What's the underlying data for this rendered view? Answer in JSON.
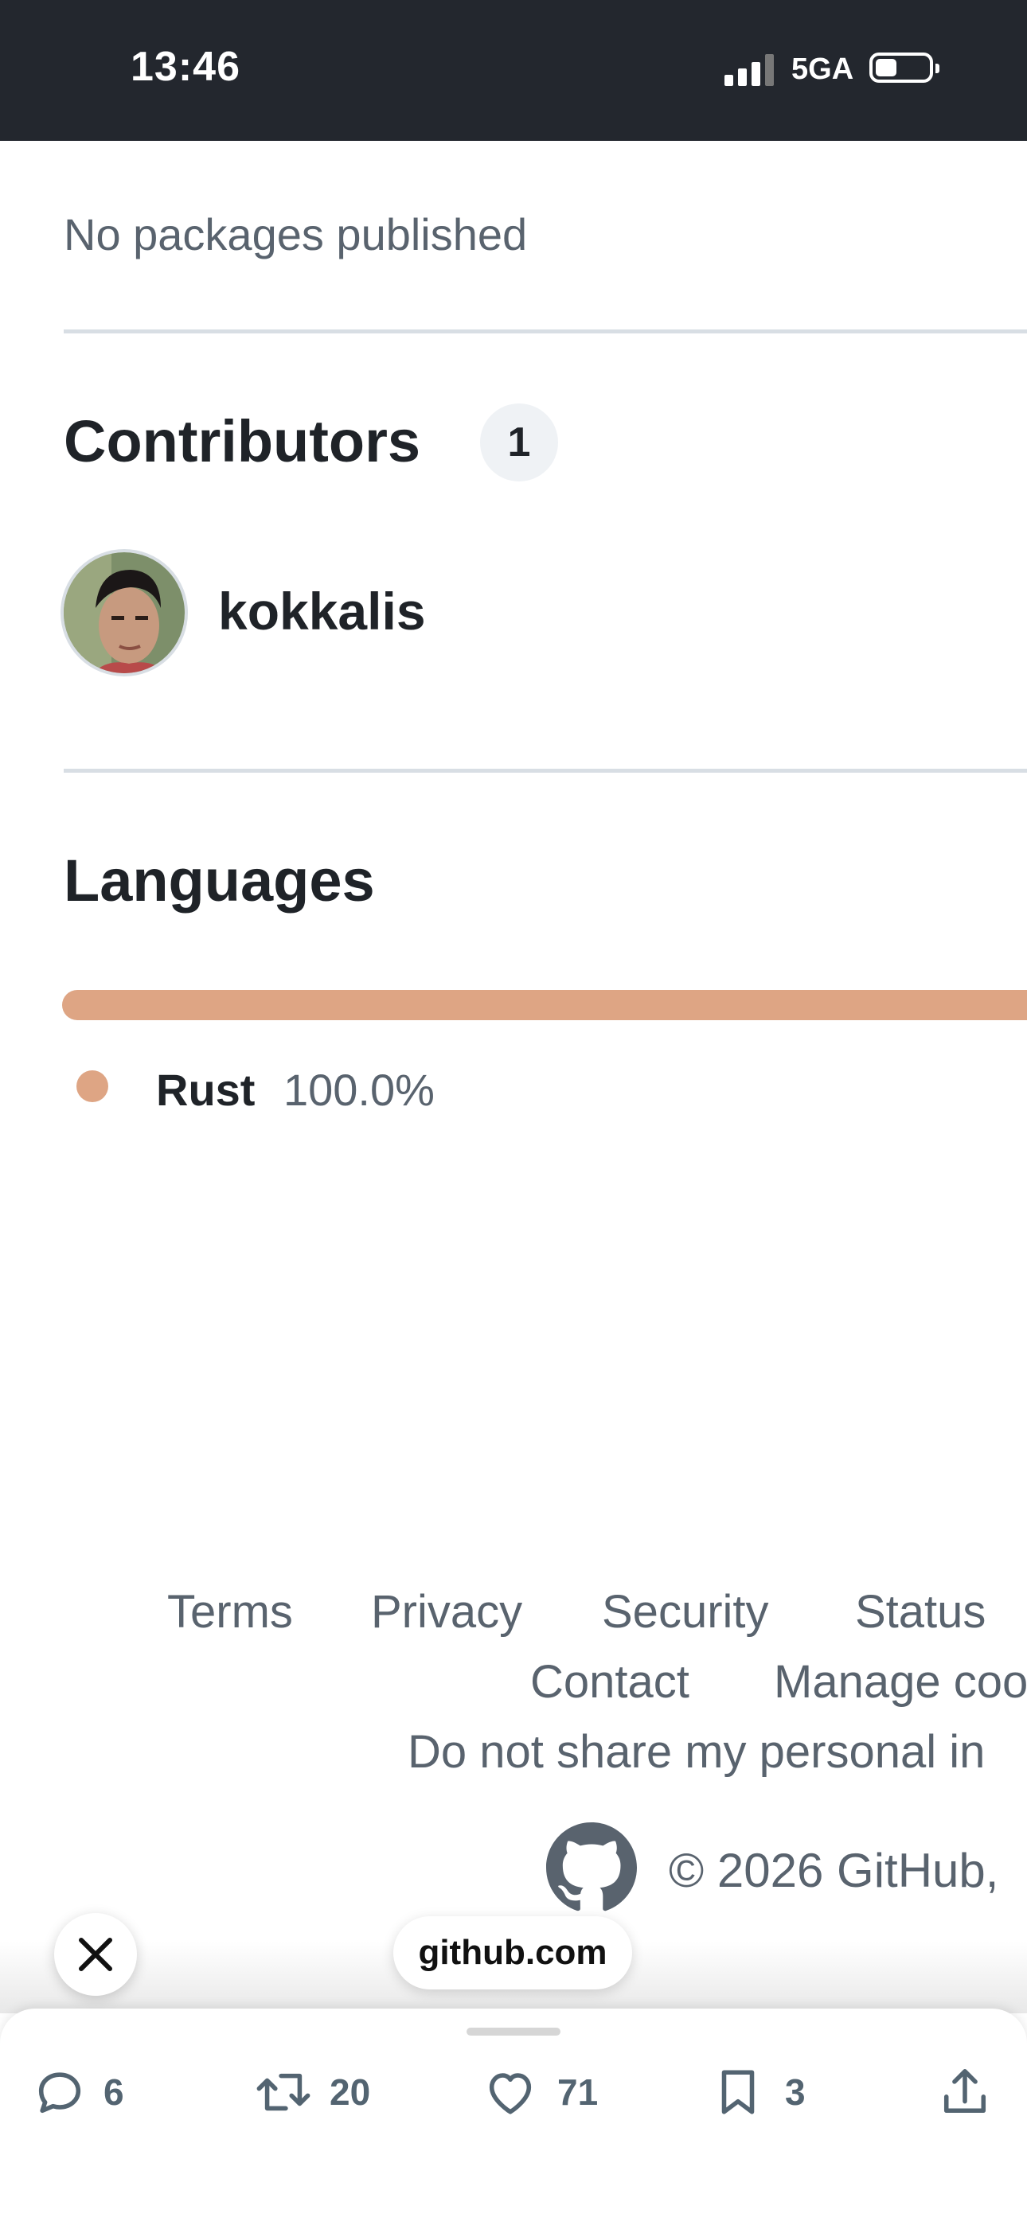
{
  "status_bar": {
    "time": "13:46",
    "network": "5GA",
    "icons": [
      "signal-icon",
      "battery-icon"
    ]
  },
  "packages": {
    "text": "No packages published"
  },
  "contributors": {
    "title": "Contributors",
    "count": "1",
    "items": [
      {
        "name": "kokkalis"
      }
    ]
  },
  "languages": {
    "title": "Languages",
    "items": [
      {
        "name": "Rust",
        "percent": "100.0%",
        "share": 1.0,
        "color": "#dea584"
      }
    ]
  },
  "footer": {
    "links_row1": [
      "Terms",
      "Privacy",
      "Security",
      "Status"
    ],
    "links_row2": [
      "Contact",
      "Manage coo"
    ],
    "links_row3": [
      "Do not share my personal in"
    ],
    "copyright": "© 2026 GitHub,"
  },
  "browser": {
    "url": "github.com",
    "close_icon": "close-icon"
  },
  "actions": {
    "replies": "6",
    "reposts": "20",
    "likes": "71",
    "bookmarks": "3",
    "icons": [
      "reply-icon",
      "repost-icon",
      "like-icon",
      "bookmark-icon",
      "share-icon"
    ]
  }
}
